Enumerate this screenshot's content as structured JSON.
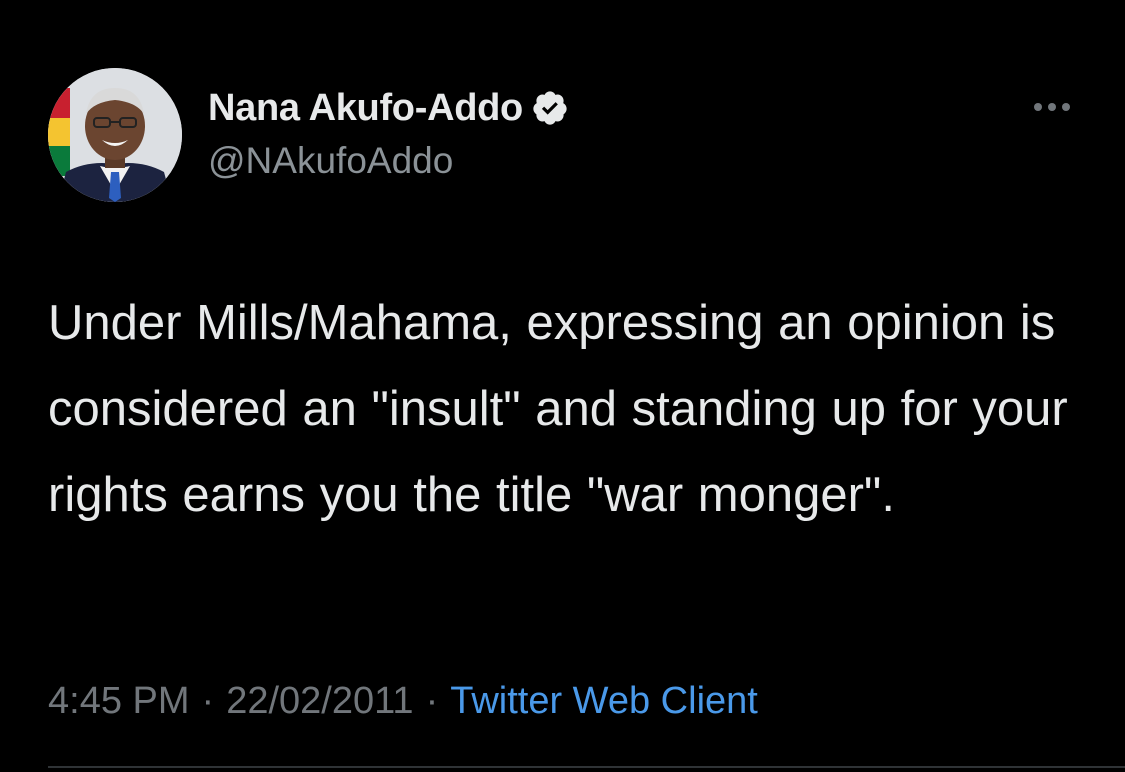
{
  "user": {
    "display_name": "Nana Akufo-Addo",
    "handle": "@NAkufoAddo",
    "verified": true,
    "avatar_icon": "profile-photo"
  },
  "tweet": {
    "text": "Under Mills/Mahama, expressing an opinion is considered an \"insult\" and standing up for your rights earns you the title \"war monger\"."
  },
  "meta": {
    "time": "4:45 PM",
    "separator": "·",
    "date": "22/02/2011",
    "source": "Twitter Web Client"
  },
  "colors": {
    "background": "#000000",
    "primary_text": "#e7e9ea",
    "secondary_text": "#71767b",
    "link": "#4a99e9",
    "verified_badge": "#e7e9ea"
  },
  "icons": {
    "more": "more-horizontal-icon",
    "verified": "verified-badge-icon"
  }
}
